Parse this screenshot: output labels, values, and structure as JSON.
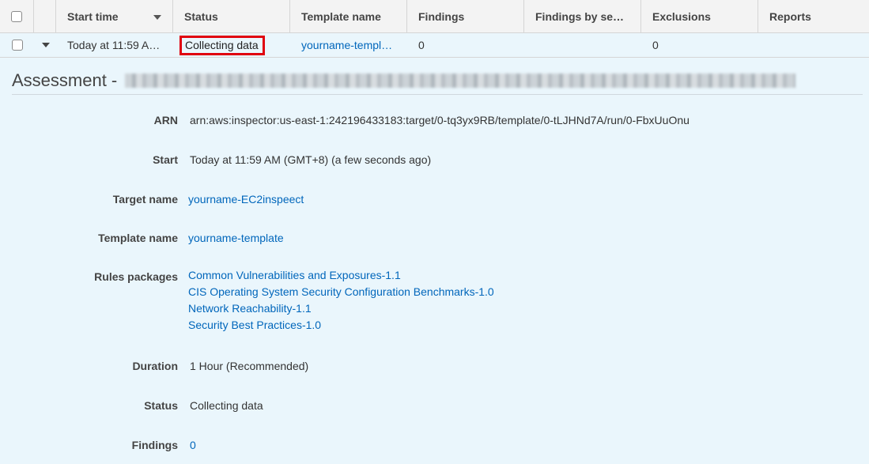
{
  "table": {
    "columns": [
      "Start time",
      "Status",
      "Template name",
      "Findings",
      "Findings by se…",
      "Exclusions",
      "Reports"
    ],
    "row": {
      "start_time": "Today at 11:59 A…",
      "status": "Collecting data",
      "template_name": "yourname-templ…",
      "findings": "0",
      "exclusions": "0"
    }
  },
  "assessment": {
    "title": "Assessment -",
    "fields": {
      "arn_label": "ARN",
      "arn_value": "arn:aws:inspector:us-east-1:242196433183:target/0-tq3yx9RB/template/0-tLJHNd7A/run/0-FbxUuOnu",
      "start_label": "Start",
      "start_value": "Today at 11:59 AM (GMT+8) (a few seconds ago)",
      "target_label": "Target name",
      "target_value": "yourname-EC2inspeect",
      "template_label": "Template name",
      "template_value": "yourname-template",
      "rules_label": "Rules packages",
      "rules": [
        "Common Vulnerabilities and Exposures-1.1",
        "CIS Operating System Security Configuration Benchmarks-1.0",
        "Network Reachability-1.1",
        "Security Best Practices-1.0"
      ],
      "duration_label": "Duration",
      "duration_value": "1 Hour (Recommended)",
      "status_label": "Status",
      "status_value": "Collecting data",
      "findings_label": "Findings",
      "findings_value": "0"
    }
  },
  "colors": {
    "link": "#0066bb",
    "highlight": "#e0000f",
    "row_bg": "#eaf6fc",
    "header_bg": "#f3f3f3"
  }
}
